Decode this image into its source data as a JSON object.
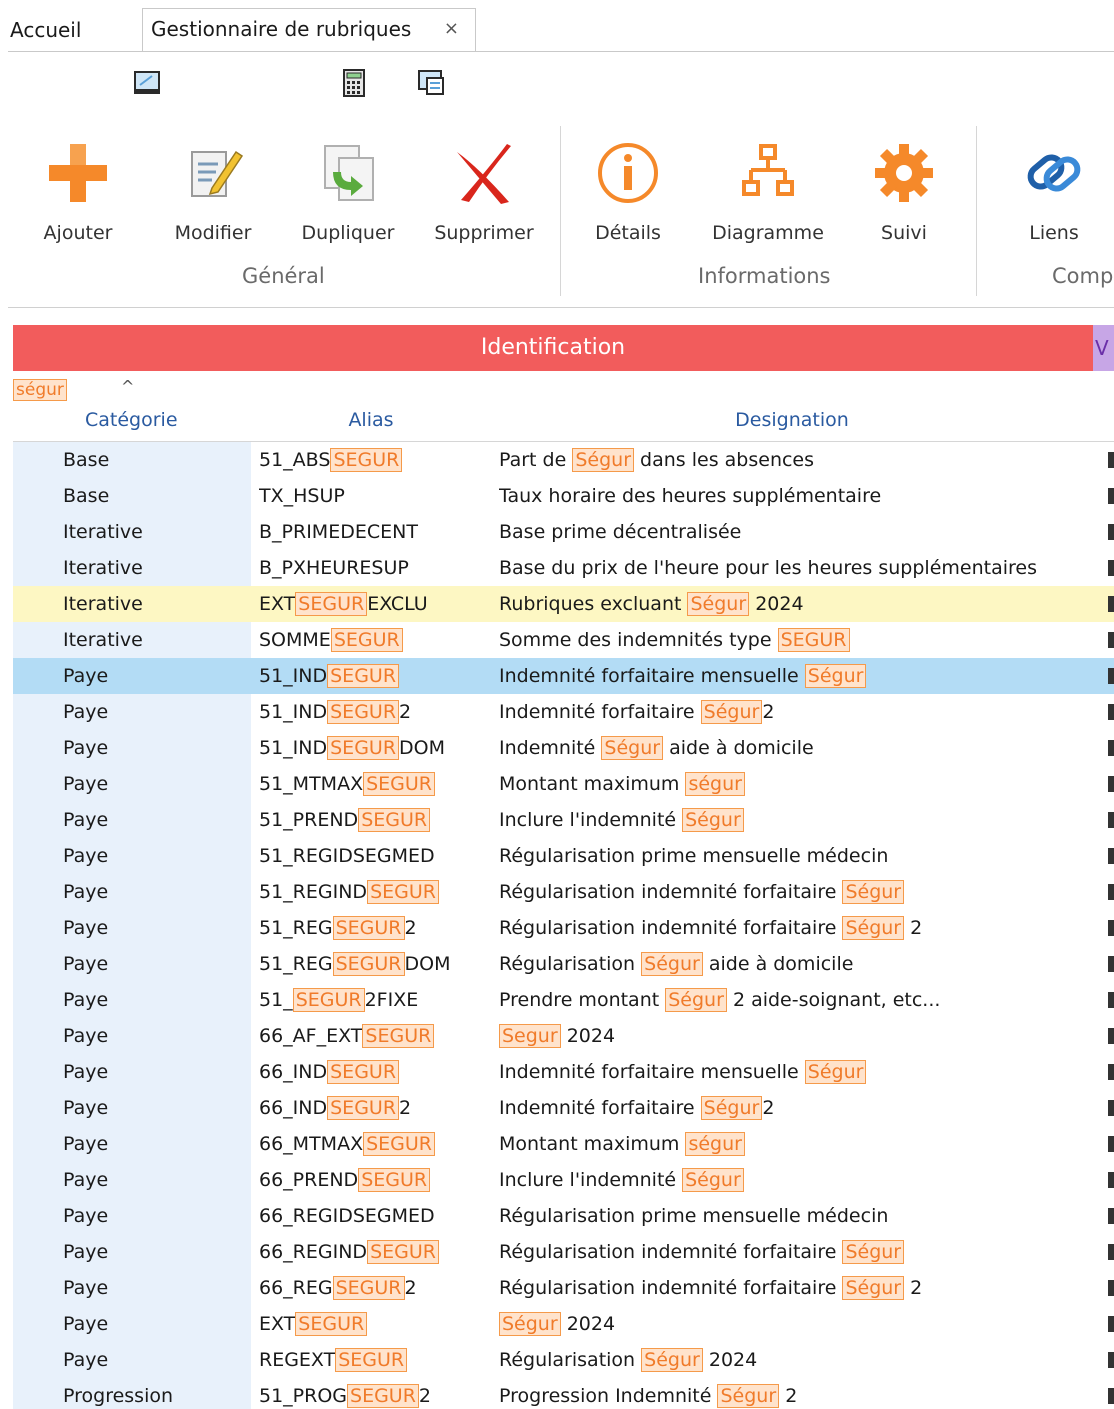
{
  "tabs": {
    "home": "Accueil",
    "active": "Gestionnaire de rubriques",
    "close": "×"
  },
  "quick_toolbar": [
    "monitor-icon",
    "calculator-icon",
    "window-icon"
  ],
  "ribbon": {
    "groups": [
      {
        "label": "Général",
        "buttons": [
          {
            "label": "Ajouter",
            "icon": "plus-icon"
          },
          {
            "label": "Modifier",
            "icon": "edit-icon"
          },
          {
            "label": "Dupliquer",
            "icon": "duplicate-icon"
          },
          {
            "label": "Supprimer",
            "icon": "delete-icon"
          }
        ]
      },
      {
        "label": "Informations",
        "buttons": [
          {
            "label": "Détails",
            "icon": "info-icon"
          },
          {
            "label": "Diagramme",
            "icon": "diagram-icon"
          },
          {
            "label": "Suivi",
            "icon": "gear-icon"
          }
        ]
      },
      {
        "label": "Comp",
        "buttons": [
          {
            "label": "Liens",
            "icon": "link-icon"
          }
        ]
      }
    ]
  },
  "grid": {
    "band_title": "Identification",
    "band2_title": "V",
    "filter_chip": "ségur",
    "columns": [
      "Catégorie",
      "Alias",
      "Designation"
    ],
    "rows": [
      {
        "cat": "Base",
        "alias": [
          [
            "51_ABS",
            0
          ],
          [
            "SEGUR",
            1
          ]
        ],
        "des": [
          [
            "Part de ",
            0
          ],
          [
            "Ségur",
            1
          ],
          [
            " dans les absences",
            0
          ]
        ]
      },
      {
        "cat": "Base",
        "alias": [
          [
            "TX_HSUP",
            0
          ]
        ],
        "des": [
          [
            "Taux horaire des heures supplémentaire",
            0
          ]
        ]
      },
      {
        "cat": "Iterative",
        "alias": [
          [
            "B_PRIMEDECENT",
            0
          ]
        ],
        "des": [
          [
            "Base prime décentralisée",
            0
          ]
        ]
      },
      {
        "cat": "Iterative",
        "alias": [
          [
            "B_PXHEURESUP",
            0
          ]
        ],
        "des": [
          [
            "Base du prix de l'heure pour les heures supplémentaires",
            0
          ]
        ]
      },
      {
        "cat": "Iterative",
        "hl": "yellow",
        "alias": [
          [
            "EXT",
            0
          ],
          [
            "SEGUR",
            1
          ],
          [
            "EXCLU",
            0
          ]
        ],
        "des": [
          [
            "Rubriques excluant ",
            0
          ],
          [
            "Ségur",
            1
          ],
          [
            " 2024",
            0
          ]
        ]
      },
      {
        "cat": "Iterative",
        "alias": [
          [
            "SOMME",
            0
          ],
          [
            "SEGUR",
            1
          ]
        ],
        "des": [
          [
            "Somme des indemnités type ",
            0
          ],
          [
            "SEGUR",
            1
          ]
        ]
      },
      {
        "cat": "Paye",
        "hl": "blue",
        "alias": [
          [
            "51_IND",
            0
          ],
          [
            "SEGUR",
            1
          ]
        ],
        "des": [
          [
            "Indemnité forfaitaire mensuelle ",
            0
          ],
          [
            "Ségur",
            1
          ]
        ]
      },
      {
        "cat": "Paye",
        "alias": [
          [
            "51_IND",
            0
          ],
          [
            "SEGUR",
            1
          ],
          [
            "2",
            0
          ]
        ],
        "des": [
          [
            "Indemnité forfaitaire ",
            0
          ],
          [
            "Ségur",
            1
          ],
          [
            "2",
            0
          ]
        ]
      },
      {
        "cat": "Paye",
        "alias": [
          [
            "51_IND",
            0
          ],
          [
            "SEGUR",
            1
          ],
          [
            "DOM",
            0
          ]
        ],
        "des": [
          [
            "Indemnité ",
            0
          ],
          [
            "Ségur",
            1
          ],
          [
            " aide à domicile",
            0
          ]
        ]
      },
      {
        "cat": "Paye",
        "alias": [
          [
            "51_MTMAX",
            0
          ],
          [
            "SEGUR",
            1
          ]
        ],
        "des": [
          [
            "Montant maximum ",
            0
          ],
          [
            "ségur",
            1
          ]
        ]
      },
      {
        "cat": "Paye",
        "alias": [
          [
            "51_PREND",
            0
          ],
          [
            "SEGUR",
            1
          ]
        ],
        "des": [
          [
            "Inclure l'indemnité ",
            0
          ],
          [
            "Ségur",
            1
          ]
        ]
      },
      {
        "cat": "Paye",
        "alias": [
          [
            "51_REGIDSEGMED",
            0
          ]
        ],
        "des": [
          [
            "Régularisation prime mensuelle médecin",
            0
          ]
        ]
      },
      {
        "cat": "Paye",
        "alias": [
          [
            "51_REGIND",
            0
          ],
          [
            "SEGUR",
            1
          ]
        ],
        "des": [
          [
            "Régularisation indemnité forfaitaire ",
            0
          ],
          [
            "Ségur",
            1
          ]
        ]
      },
      {
        "cat": "Paye",
        "alias": [
          [
            "51_REG",
            0
          ],
          [
            "SEGUR",
            1
          ],
          [
            "2",
            0
          ]
        ],
        "des": [
          [
            "Régularisation indemnité forfaitaire ",
            0
          ],
          [
            "Ségur",
            1
          ],
          [
            " 2",
            0
          ]
        ]
      },
      {
        "cat": "Paye",
        "alias": [
          [
            "51_REG",
            0
          ],
          [
            "SEGUR",
            1
          ],
          [
            "DOM",
            0
          ]
        ],
        "des": [
          [
            "Régularisation ",
            0
          ],
          [
            "Ségur",
            1
          ],
          [
            " aide à domicile",
            0
          ]
        ]
      },
      {
        "cat": "Paye",
        "alias": [
          [
            "51_",
            0
          ],
          [
            "SEGUR",
            1
          ],
          [
            "2FIXE",
            0
          ]
        ],
        "des": [
          [
            "Prendre montant ",
            0
          ],
          [
            "Ségur",
            1
          ],
          [
            " 2 aide-soignant, etc...",
            0
          ]
        ]
      },
      {
        "cat": "Paye",
        "alias": [
          [
            "66_AF_EXT",
            0
          ],
          [
            "SEGUR",
            1
          ]
        ],
        "des": [
          [
            "Segur",
            1
          ],
          [
            " 2024",
            0
          ]
        ]
      },
      {
        "cat": "Paye",
        "alias": [
          [
            "66_IND",
            0
          ],
          [
            "SEGUR",
            1
          ]
        ],
        "des": [
          [
            "Indemnité forfaitaire mensuelle ",
            0
          ],
          [
            "Ségur",
            1
          ]
        ]
      },
      {
        "cat": "Paye",
        "alias": [
          [
            "66_IND",
            0
          ],
          [
            "SEGUR",
            1
          ],
          [
            "2",
            0
          ]
        ],
        "des": [
          [
            "Indemnité forfaitaire ",
            0
          ],
          [
            "Ségur",
            1
          ],
          [
            "2",
            0
          ]
        ]
      },
      {
        "cat": "Paye",
        "alias": [
          [
            "66_MTMAX",
            0
          ],
          [
            "SEGUR",
            1
          ]
        ],
        "des": [
          [
            "Montant maximum ",
            0
          ],
          [
            "ségur",
            1
          ]
        ]
      },
      {
        "cat": "Paye",
        "alias": [
          [
            "66_PREND",
            0
          ],
          [
            "SEGUR",
            1
          ]
        ],
        "des": [
          [
            "Inclure l'indemnité ",
            0
          ],
          [
            "Ségur",
            1
          ]
        ]
      },
      {
        "cat": "Paye",
        "alias": [
          [
            "66_REGIDSEGMED",
            0
          ]
        ],
        "des": [
          [
            "Régularisation prime mensuelle médecin",
            0
          ]
        ]
      },
      {
        "cat": "Paye",
        "alias": [
          [
            "66_REGIND",
            0
          ],
          [
            "SEGUR",
            1
          ]
        ],
        "des": [
          [
            "Régularisation indemnité forfaitaire ",
            0
          ],
          [
            "Ségur",
            1
          ]
        ]
      },
      {
        "cat": "Paye",
        "alias": [
          [
            "66_REG",
            0
          ],
          [
            "SEGUR",
            1
          ],
          [
            "2",
            0
          ]
        ],
        "des": [
          [
            "Régularisation indemnité forfaitaire ",
            0
          ],
          [
            "Ségur",
            1
          ],
          [
            " 2",
            0
          ]
        ]
      },
      {
        "cat": "Paye",
        "alias": [
          [
            "EXT",
            0
          ],
          [
            "SEGUR",
            1
          ]
        ],
        "des": [
          [
            "Ségur",
            1
          ],
          [
            " 2024",
            0
          ]
        ]
      },
      {
        "cat": "Paye",
        "alias": [
          [
            "REGEXT",
            0
          ],
          [
            "SEGUR",
            1
          ]
        ],
        "des": [
          [
            "Régularisation ",
            0
          ],
          [
            "Ségur",
            1
          ],
          [
            " 2024",
            0
          ]
        ]
      },
      {
        "cat": "Progression",
        "alias": [
          [
            "51_PROG",
            0
          ],
          [
            "SEGUR",
            1
          ],
          [
            "2",
            0
          ]
        ],
        "des": [
          [
            "Progression Indemnité ",
            0
          ],
          [
            "Ségur",
            1
          ],
          [
            " 2",
            0
          ]
        ]
      }
    ]
  },
  "colors": {
    "band": "#f25c5c",
    "chip_border": "#f59a4a",
    "row_selected": "#b3dcf5",
    "row_highlight": "#fdf7c3"
  }
}
